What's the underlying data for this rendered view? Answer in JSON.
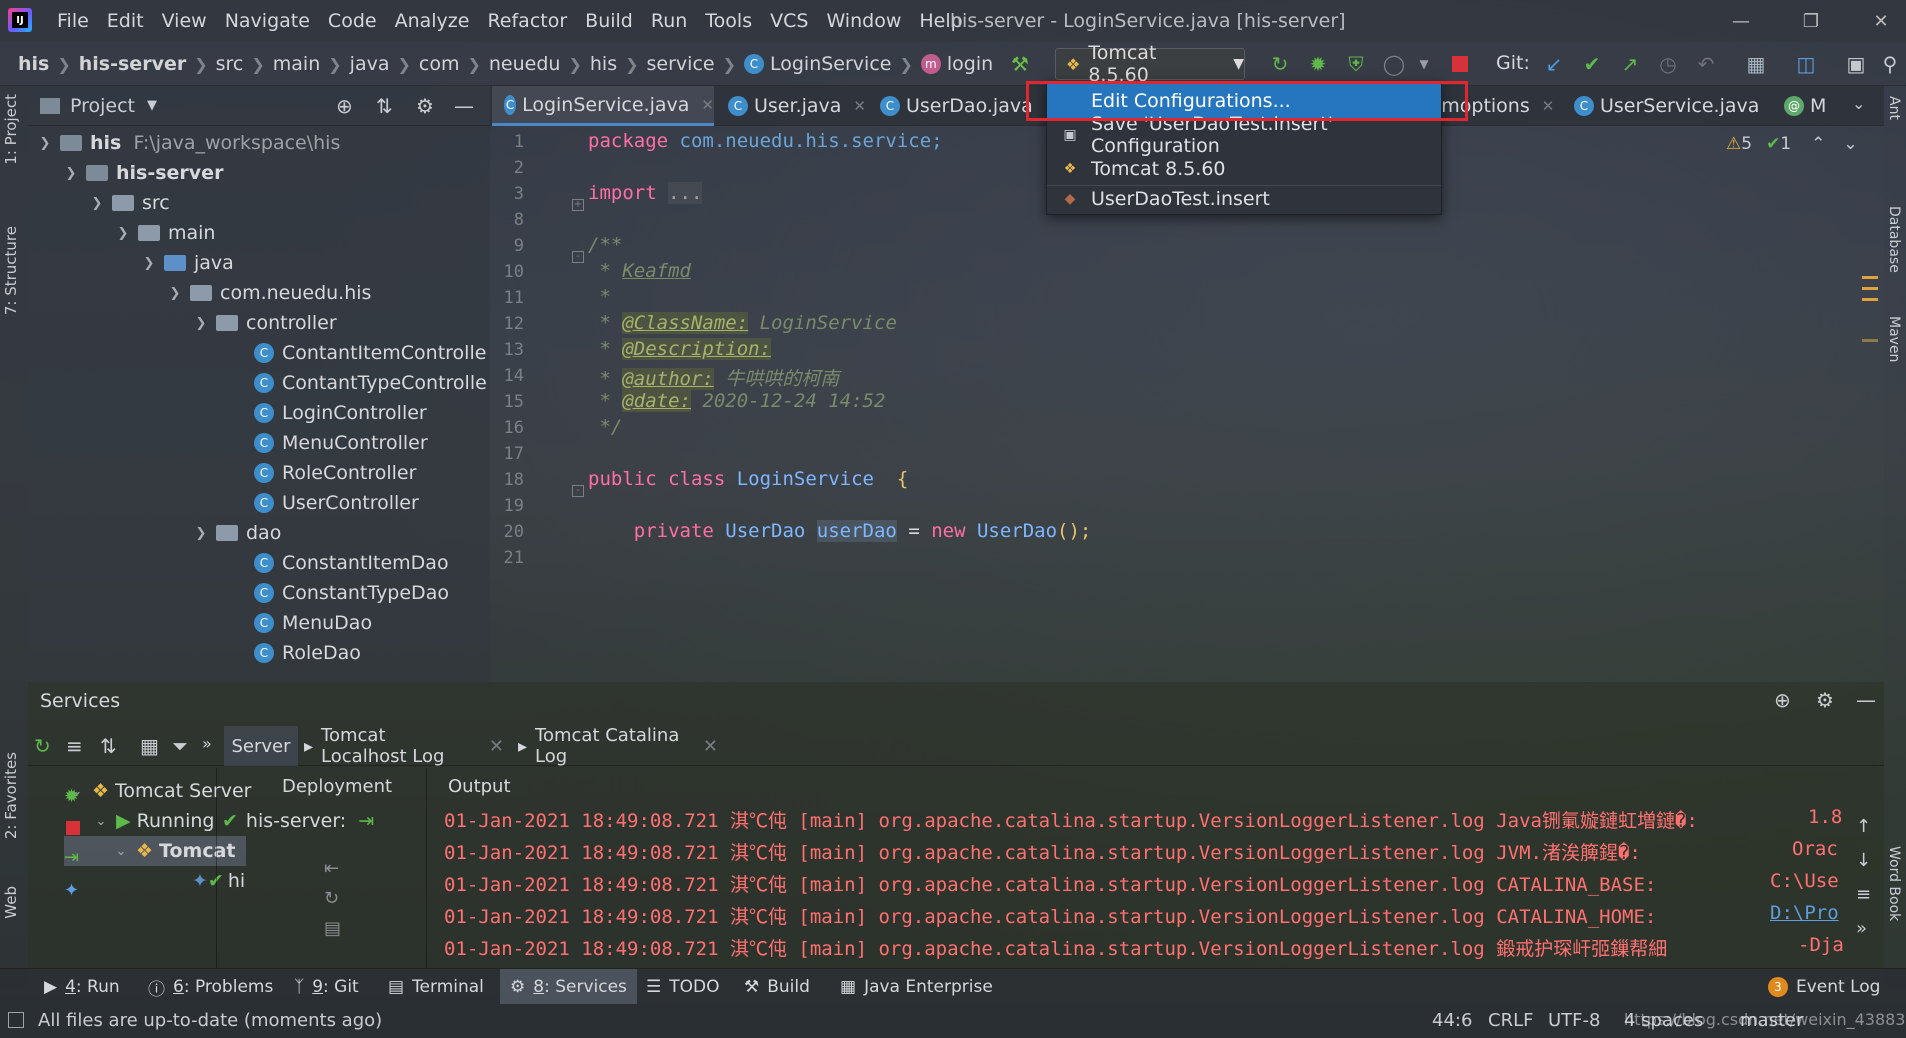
{
  "menubar": {
    "items": [
      "File",
      "Edit",
      "View",
      "Navigate",
      "Code",
      "Analyze",
      "Refactor",
      "Build",
      "Run",
      "Tools",
      "VCS",
      "Window",
      "Help"
    ],
    "title": "his-server - LoginService.java [his-server]"
  },
  "breadcrumb": {
    "items": [
      "his",
      "his-server",
      "src",
      "main",
      "java",
      "com",
      "neuedu",
      "his",
      "service",
      "LoginService",
      "login"
    ]
  },
  "toolbar": {
    "run_config": "Tomcat 8.5.60",
    "git_label": "Git:"
  },
  "dropdown": {
    "items": [
      "Edit Configurations...",
      "Save 'UserDaoTest.insert' Configuration",
      "Tomcat 8.5.60",
      "UserDaoTest.insert"
    ]
  },
  "project": {
    "header": "Project",
    "root_name": "his",
    "root_path": "F:\\java_workspace\\his",
    "rows": [
      "his-server",
      "src",
      "main",
      "java",
      "com.neuedu.his",
      "controller",
      "ContantItemControlle",
      "ContantTypeControlle",
      "LoginController",
      "MenuController",
      "RoleController",
      "UserController",
      "dao",
      "ConstantItemDao",
      "ConstantTypeDao",
      "MenuDao",
      "RoleDao"
    ]
  },
  "editor": {
    "tabs": [
      "LoginService.java",
      "User.java",
      "UserDao.java",
      "vmoptions",
      "UserService.java",
      "M"
    ],
    "warnings": "5",
    "checks": "1",
    "line_numbers": [
      "1",
      "2",
      "3",
      "8",
      "9",
      "10",
      "11",
      "12",
      "13",
      "14",
      "15",
      "16",
      "17",
      "18",
      "19",
      "20",
      "21"
    ],
    "code": {
      "l1a": "package ",
      "l1b": "com.neuedu.his.service;",
      "l3a": "import ",
      "l3b": "...",
      "l9": "/**",
      "l10a": " * ",
      "l10b": "Keafmd",
      "l11": " *",
      "l12a": " * ",
      "l12b": "@ClassName:",
      "l12c": " LoginService",
      "l13a": " * ",
      "l13b": "@Description:",
      "l14a": " * ",
      "l14b": "@author:",
      "l14c": " 牛哄哄的柯南",
      "l15a": " * ",
      "l15b": "@date:",
      "l15c": " 2020-12-24 14:52",
      "l16": " */",
      "l18a": "public class ",
      "l18b": "LoginService",
      "l18c": "  {",
      "l20a": "    private ",
      "l20b": "UserDao ",
      "l20c": "userDao",
      "l20d": " = ",
      "l20e": "new ",
      "l20f": "UserDao",
      "l20g": "();"
    }
  },
  "services": {
    "title": "Services",
    "tabs": [
      "Server",
      "Tomcat Localhost Log",
      "Tomcat Catalina Log"
    ],
    "tree": [
      "Tomcat Server",
      "Running",
      "Tomcat",
      "hi"
    ],
    "deployment_header": "Deployment",
    "deployment_item": "his-server:",
    "output_header": "Output",
    "log_lines": [
      "01-Jan-2021 18:49:08.721 淇℃伅 [main] org.apache.catalina.startup.VersionLoggerListener.log Java铏氭嫙鏈虹増鏈�:",
      "01-Jan-2021 18:49:08.721 淇℃伅 [main] org.apache.catalina.startup.VersionLoggerListener.log JVM.渚涘簲鍟�:",
      "01-Jan-2021 18:49:08.721 淇℃伅 [main] org.apache.catalina.startup.VersionLoggerListener.log CATALINA_BASE:",
      "01-Jan-2021 18:49:08.721 淇℃伅 [main] org.apache.catalina.startup.VersionLoggerListener.log CATALINA_HOME:",
      "01-Jan-2021 18:49:08.721 淇℃伅 [main] org.apache.catalina.startup.VersionLoggerListener.log 鍛戒护琛屽弬鏁帮細"
    ],
    "log_right": [
      "1.8",
      "Orac",
      "C:\\Use",
      "D:\\Pro",
      "-Dja"
    ]
  },
  "bottom_tabs": [
    {
      "num": "4",
      "label": ": Run"
    },
    {
      "num": "6",
      "label": ": Problems"
    },
    {
      "num": "9",
      "label": ": Git"
    },
    {
      "num": "",
      "label": "Terminal"
    },
    {
      "num": "8",
      "label": ": Services"
    },
    {
      "num": "",
      "label": "TODO"
    },
    {
      "num": "",
      "label": "Build"
    },
    {
      "num": "",
      "label": "Java Enterprise"
    }
  ],
  "event_log": {
    "count": "3",
    "label": "Event Log"
  },
  "status": {
    "message": "All files are up-to-date (moments ago)",
    "position": "44:6",
    "line_sep": "CRLF",
    "encoding": "UTF-8",
    "watermark": "https://blog.csdn.net/weixin_43883917",
    "indent": "4 spaces",
    "branch": "master"
  },
  "side": {
    "left": [
      "1: Project",
      "7: Structure",
      "2: Favorites",
      "Web"
    ],
    "right": [
      "Ant",
      "Database",
      "Maven",
      "Word Book"
    ]
  }
}
